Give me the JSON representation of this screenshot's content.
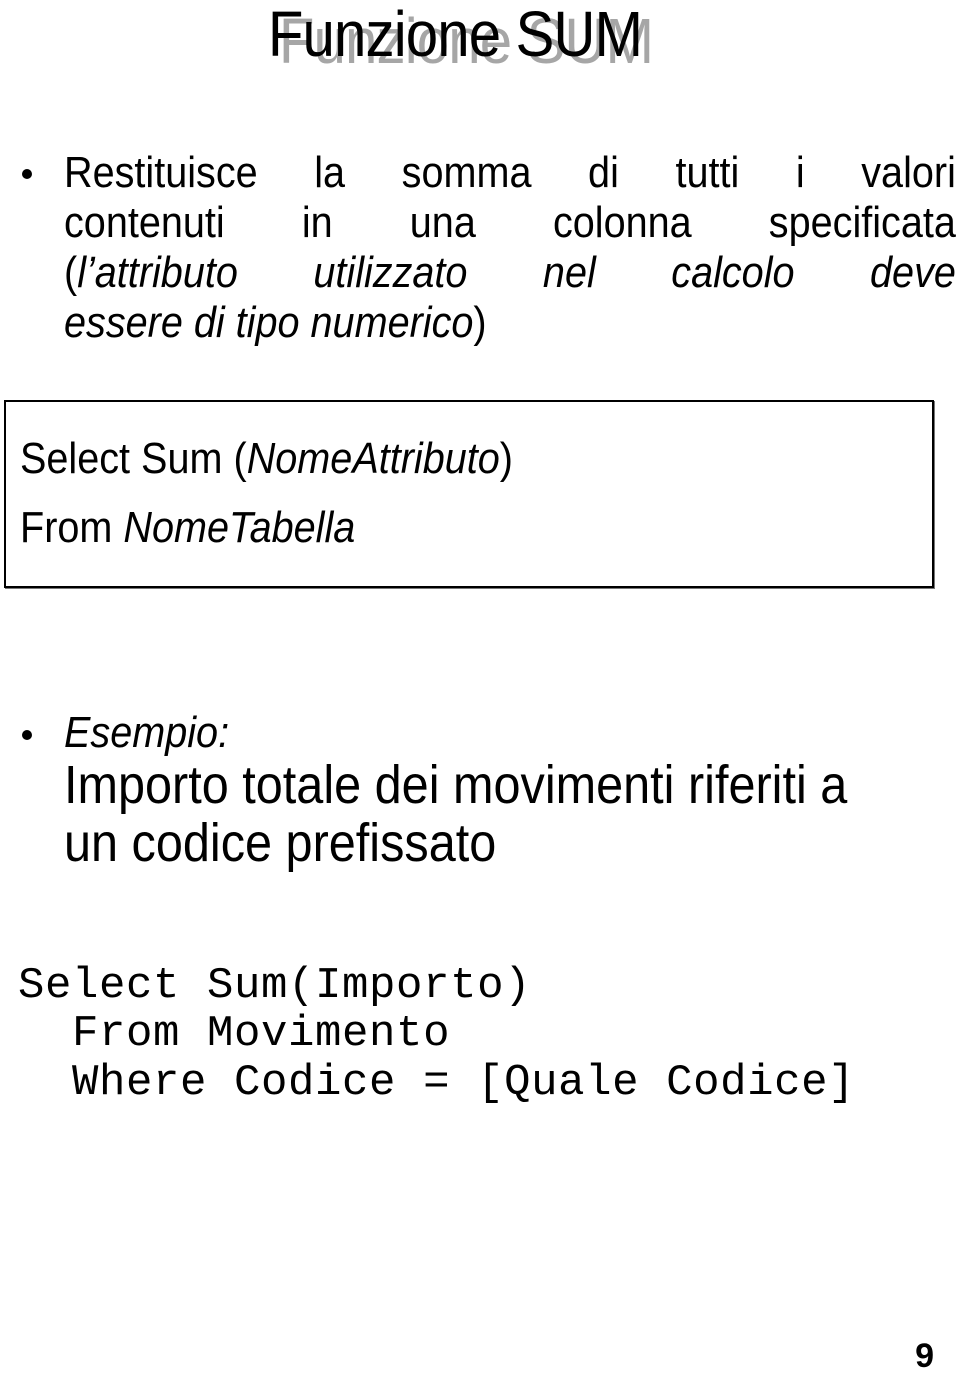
{
  "slide": {
    "title": "Funzione SUM",
    "bullets": [
      {
        "lines": [
          [
            {
              "text": "Restituisce la somma di tutti i valori",
              "italic": false
            }
          ],
          [
            {
              "text": "contenuti in una colonna specificata",
              "italic": false
            }
          ],
          [
            {
              "text": "(",
              "italic": false
            },
            {
              "text": "l’attributo utilizzato nel calcolo deve",
              "italic": true
            }
          ],
          [
            {
              "text": "essere di tipo numerico",
              "italic": true
            },
            {
              "text": ")",
              "italic": false
            }
          ]
        ]
      }
    ],
    "syntax_box": {
      "line1_prefix": "Select Sum (",
      "line1_arg": "NomeAttributo",
      "line1_suffix": ")",
      "line2_prefix": "From ",
      "line2_arg": "NomeTabella"
    },
    "example": {
      "label": "Esempio:",
      "description_lines": [
        "Importo totale dei movimenti riferiti a",
        "un codice prefissato"
      ]
    },
    "code": [
      "Select Sum(Importo)",
      "  From Movimento",
      "  Where Codice = [Quale Codice]"
    ],
    "page_number": "9"
  }
}
